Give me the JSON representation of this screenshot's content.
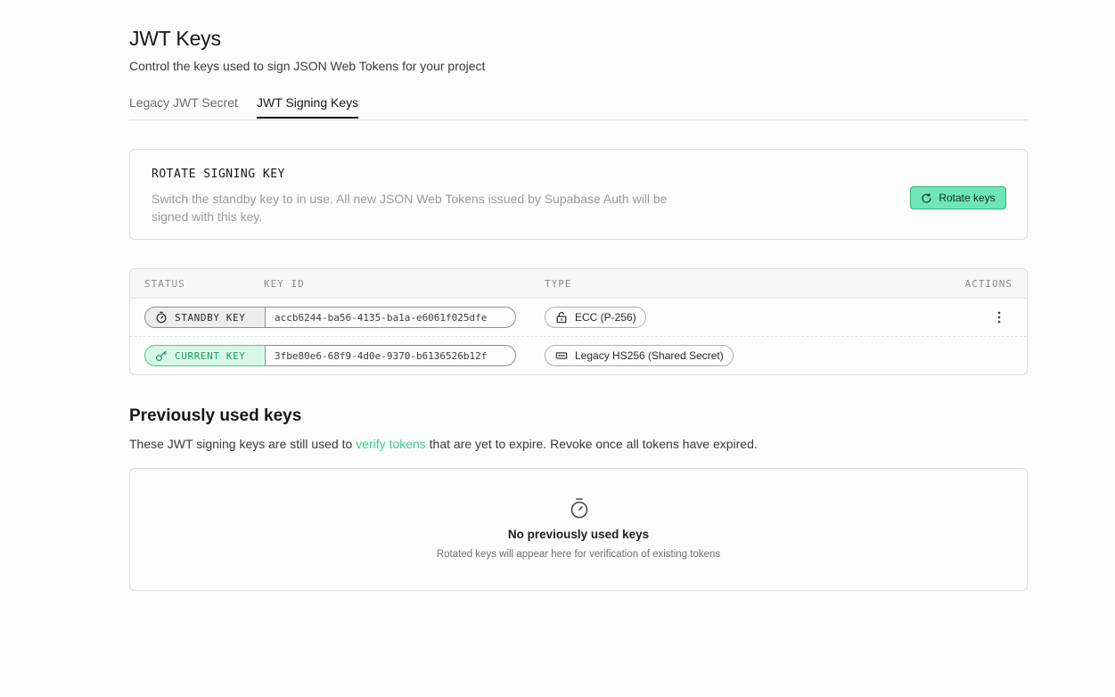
{
  "header": {
    "title": "JWT Keys",
    "subtitle": "Control the keys used to sign JSON Web Tokens for your project"
  },
  "tabs": [
    {
      "label": "Legacy JWT Secret",
      "active": false
    },
    {
      "label": "JWT Signing Keys",
      "active": true
    }
  ],
  "rotate": {
    "title": "ROTATE SIGNING KEY",
    "description": "Switch the standby key to in use. All new JSON Web Tokens issued by Supabase Auth will be signed with this key.",
    "button_label": "Rotate keys",
    "button_icon": "refresh-icon"
  },
  "keys_table": {
    "headers": {
      "status": "STATUS",
      "key_id": "KEY ID",
      "type": "TYPE",
      "actions": "ACTIONS"
    },
    "rows": [
      {
        "status": "STANDBY KEY",
        "status_icon": "timer-icon",
        "key_id": "accb6244-ba56-4135-ba1a-e6061f025dfe",
        "type": "ECC (P-256)",
        "type_icon": "lock-icon",
        "has_actions": true
      },
      {
        "status": "CURRENT KEY",
        "status_icon": "key-icon",
        "key_id": "3fbe80e6-68f9-4d0e-9370-b6136526b12f",
        "type": "Legacy HS256 (Shared Secret)",
        "type_icon": "password-icon",
        "has_actions": false
      }
    ]
  },
  "previous": {
    "title": "Previously used keys",
    "description_before": "These JWT signing keys are still used to ",
    "description_link": "verify tokens",
    "description_after": " that are yet to expire. Revoke once all tokens have expired.",
    "empty_title": "No previously used keys",
    "empty_subtitle": "Rotated keys will appear here for verification of existing tokens",
    "empty_icon": "timer-icon"
  },
  "colors": {
    "accent": "#3ecf8e",
    "button_bg": "#6ee7b7"
  }
}
